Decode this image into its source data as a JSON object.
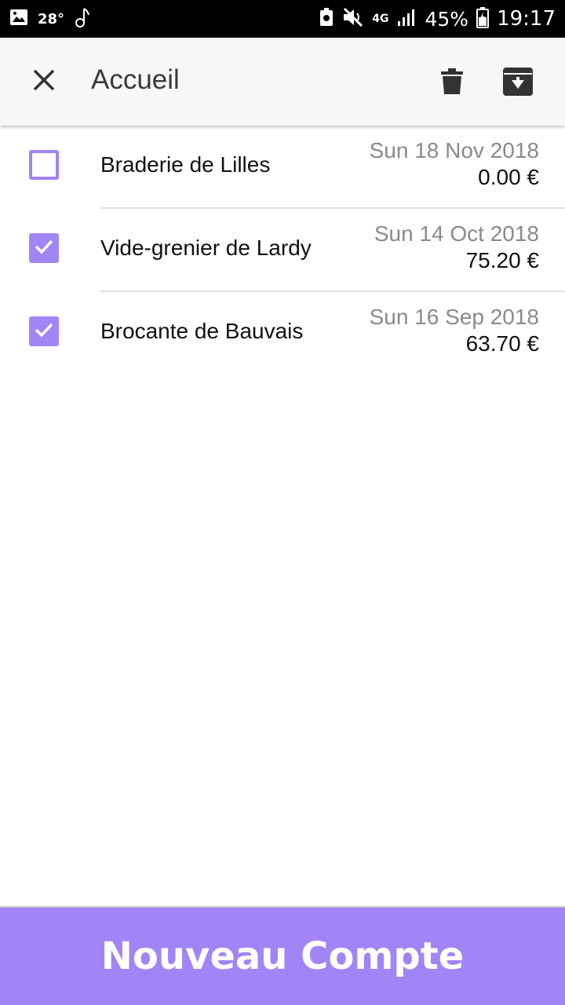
{
  "status_bar": {
    "temperature": "28°",
    "signal_label": "4G",
    "battery_percent": "45%",
    "time": "19:17",
    "icons": [
      "image-icon",
      "music-note-icon",
      "battery-saver-icon",
      "mute-icon",
      "signal-icon",
      "battery-icon"
    ]
  },
  "app_bar": {
    "title": "Accueil",
    "close_icon": "close-icon",
    "delete_icon": "trash-icon",
    "archive_icon": "archive-icon"
  },
  "items": [
    {
      "name": "Braderie de Lilles",
      "date": "Sun 18 Nov 2018",
      "amount": "0.00 €",
      "checked": false
    },
    {
      "name": "Vide-grenier de Lardy",
      "date": "Sun 14 Oct 2018",
      "amount": "75.20 €",
      "checked": true
    },
    {
      "name": "Brocante de Bauvais",
      "date": "Sun 16 Sep 2018",
      "amount": "63.70 €",
      "checked": true
    }
  ],
  "bottom_button": {
    "label": "Nouveau Compte"
  },
  "colors": {
    "accent": "#a184f6",
    "app_bar_bg": "#f7f7f7",
    "date_text": "#8a8a8a"
  }
}
